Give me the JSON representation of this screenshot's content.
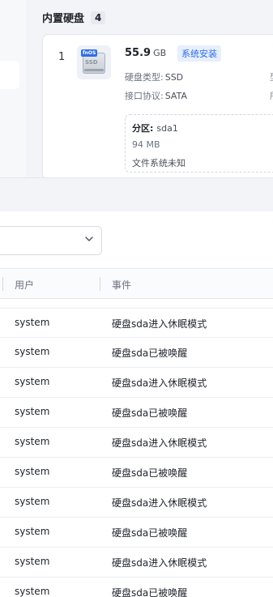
{
  "disk_section": {
    "title": "内置硬盘",
    "count": "4",
    "disk": {
      "index": "1",
      "icon_tag": "fnOS",
      "icon_text": "SSD",
      "size_value": "55.9",
      "size_unit": "GB",
      "badge": "系统安装",
      "type_label": "硬盘类型:",
      "type_value": "SSD",
      "protocol_label": "接口协议:",
      "protocol_value": "SATA",
      "cut_right_1": "型",
      "cut_right_2": "所",
      "partition": {
        "label": "分区:",
        "name": "sda1",
        "size": "94 MB",
        "filesystem": "文件系统未知"
      }
    }
  },
  "log_table": {
    "headers": {
      "user": "用户",
      "event": "事件"
    },
    "rows": [
      {
        "user": "system",
        "event": "硬盘sda进入休眠模式"
      },
      {
        "user": "system",
        "event": "硬盘sda已被唤醒"
      },
      {
        "user": "system",
        "event": "硬盘sda进入休眠模式"
      },
      {
        "user": "system",
        "event": "硬盘sda已被唤醒"
      },
      {
        "user": "system",
        "event": "硬盘sda进入休眠模式"
      },
      {
        "user": "system",
        "event": "硬盘sda已被唤醒"
      },
      {
        "user": "system",
        "event": "硬盘sda进入休眠模式"
      },
      {
        "user": "system",
        "event": "硬盘sda已被唤醒"
      },
      {
        "user": "system",
        "event": "硬盘sda进入休眠模式"
      },
      {
        "user": "system",
        "event": "硬盘sda已被唤醒"
      }
    ]
  },
  "icons": {
    "disk": "ssd-disk-icon",
    "dropdown": "chevron-down-icon"
  },
  "colors": {
    "accent": "#2b6de5",
    "badge_bg": "#e7effd",
    "panel_bg": "#f2f4f8"
  }
}
